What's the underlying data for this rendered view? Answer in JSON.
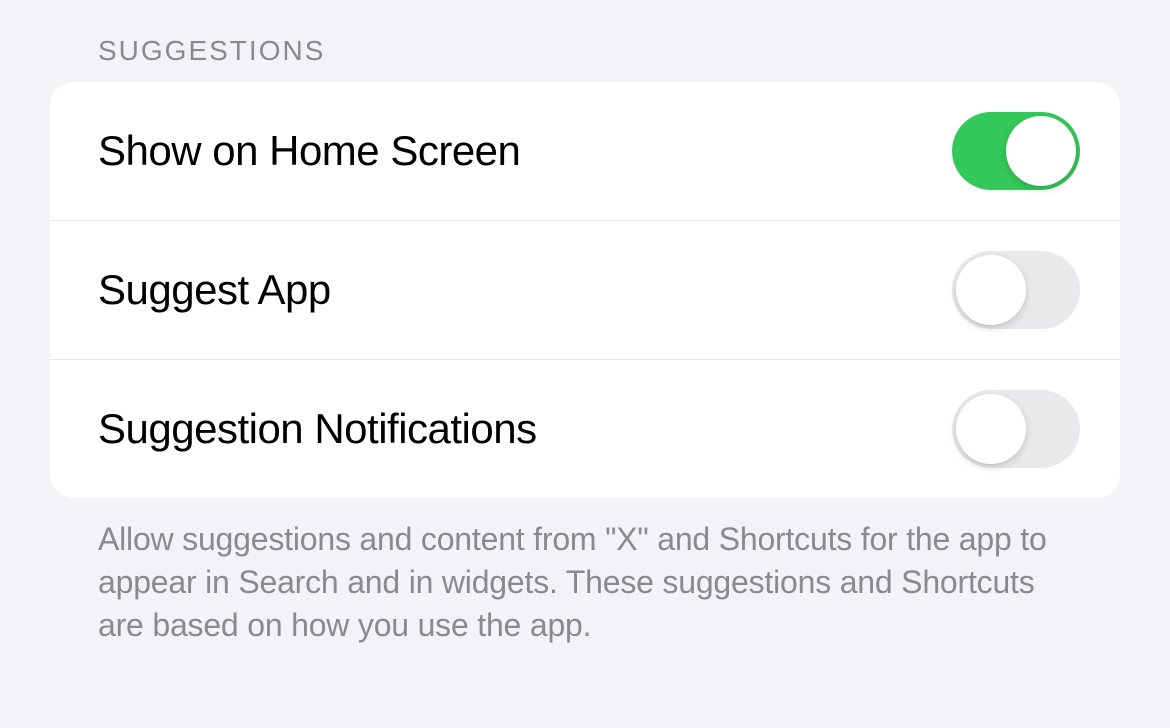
{
  "section": {
    "header": "SUGGESTIONS",
    "rows": [
      {
        "label": "Show on Home Screen",
        "on": true
      },
      {
        "label": "Suggest App",
        "on": false
      },
      {
        "label": "Suggestion Notifications",
        "on": false
      }
    ],
    "footer": "Allow suggestions and content from \"X\" and Shortcuts for the app to appear in Search and in widgets. These suggestions and Shortcuts are based on how you use the app."
  }
}
